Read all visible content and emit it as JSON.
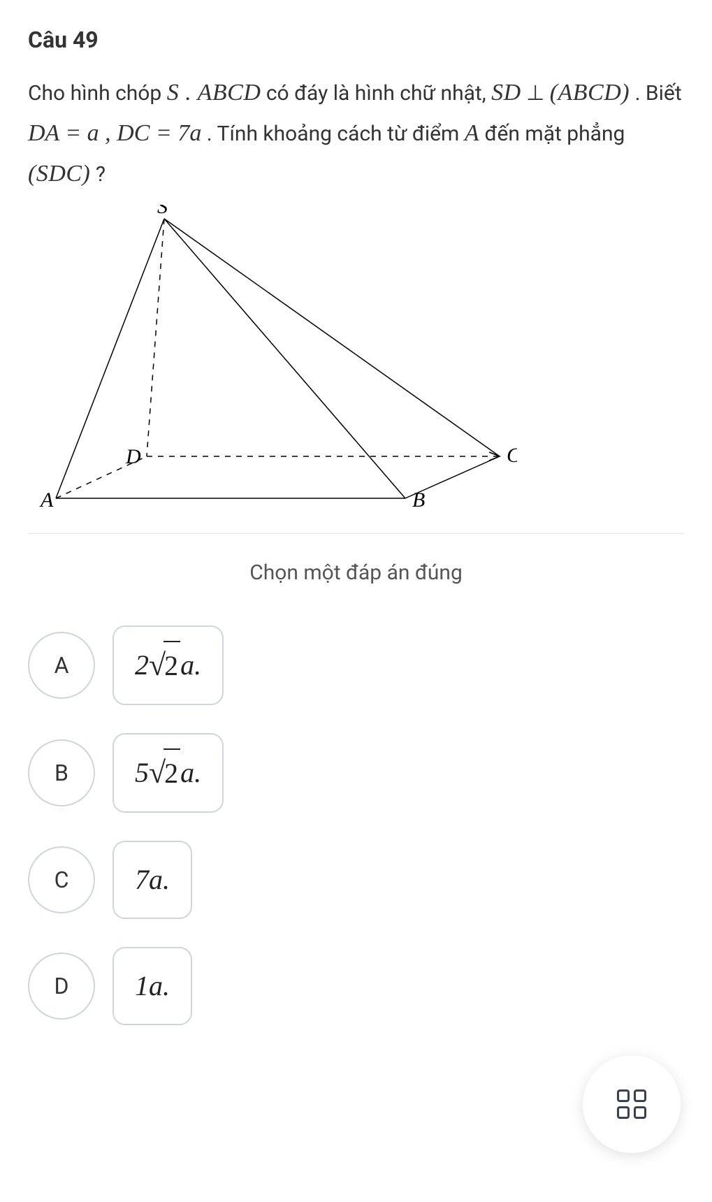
{
  "question": {
    "number_label": "Câu 49",
    "text_1": "Cho hình chóp ",
    "pyramid": "S . ABCD",
    "text_2": " có đáy là hình chữ nhật, ",
    "perp_lhs": "SD",
    "perp_symbol": "⊥",
    "perp_rhs": "(ABCD)",
    "text_3": ". Biết ",
    "cond": "DA = a , DC = 7a",
    "text_4": ". Tính khoảng cách từ điểm ",
    "point": "A",
    "text_5": " đến mặt phẳng ",
    "plane": "(SDC)",
    "qmark": "?"
  },
  "diagram": {
    "labels": {
      "S": "S",
      "A": "A",
      "B": "B",
      "C": "C",
      "D": "D"
    }
  },
  "instruction": "Chọn một đáp án đúng",
  "options": [
    {
      "letter": "A",
      "prefix": "2",
      "has_sqrt": true,
      "radicand": "2",
      "tail": "a."
    },
    {
      "letter": "B",
      "prefix": "5",
      "has_sqrt": true,
      "radicand": "2",
      "tail": "a."
    },
    {
      "letter": "C",
      "prefix": "7",
      "has_sqrt": false,
      "radicand": "",
      "tail": "a."
    },
    {
      "letter": "D",
      "prefix": "1",
      "has_sqrt": false,
      "radicand": "",
      "tail": "a."
    }
  ]
}
